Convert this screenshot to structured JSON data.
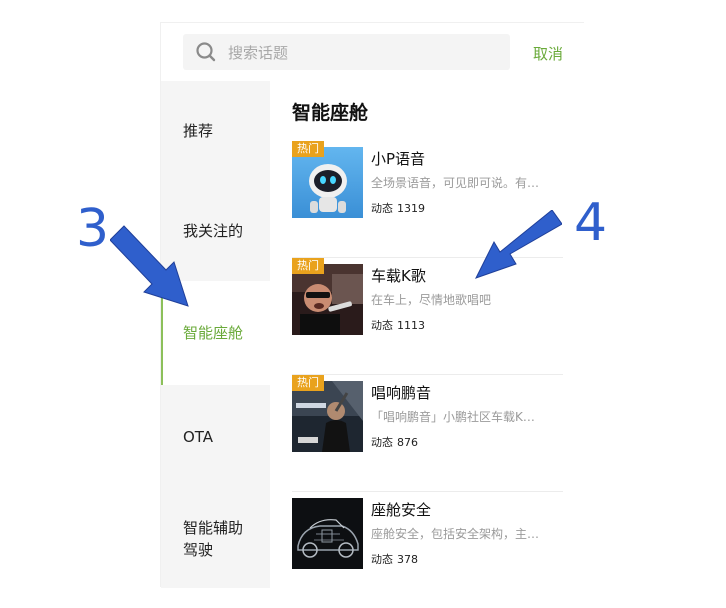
{
  "search": {
    "placeholder": "搜索话题",
    "cancel_label": "取消"
  },
  "sidebar": {
    "items": [
      {
        "label": "推荐",
        "active": false
      },
      {
        "label": "我关注的",
        "active": false
      },
      {
        "label": "智能座舱",
        "active": true
      },
      {
        "label": "OTA",
        "active": false
      },
      {
        "label": "智能辅助驾驶",
        "active": false
      }
    ],
    "accent_color": "#6aaa3a"
  },
  "main": {
    "section_title": "智能座舱",
    "stat_label": "动态",
    "hot_label": "热门",
    "topics": [
      {
        "title": "小P语音",
        "desc": "全场景语音，可见即可说。有…",
        "count": "1319",
        "hot": true,
        "image": "robot-image"
      },
      {
        "title": "车载K歌",
        "desc": "在车上，尽情地歌唱吧",
        "count": "1113",
        "hot": true,
        "image": "singer-image"
      },
      {
        "title": "唱响鹏音",
        "desc": "「唱响鹏音」小鹏社区车载K…",
        "count": "876",
        "hot": true,
        "image": "concert-image"
      },
      {
        "title": "座舱安全",
        "desc": "座舱安全，包括安全架构，主…",
        "count": "378",
        "hot": false,
        "image": "car-xray-image"
      }
    ]
  },
  "annotations": {
    "left_number": "3",
    "right_number": "4",
    "color": "#2f5fcc"
  }
}
